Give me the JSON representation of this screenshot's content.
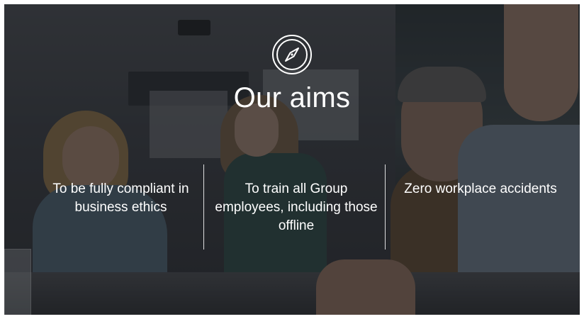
{
  "header": {
    "icon": "compass-icon",
    "title": "Our aims"
  },
  "aims": [
    {
      "text": "To be fully compliant in business ethics"
    },
    {
      "text": "To train all Group employees, including those offline"
    },
    {
      "text": "Zero workplace accidents"
    }
  ],
  "colors": {
    "text": "#ffffff",
    "divider": "#ffffff",
    "overlay": "#12141a"
  }
}
